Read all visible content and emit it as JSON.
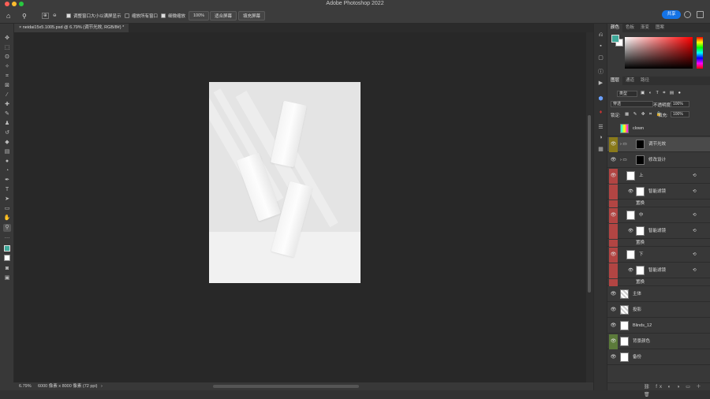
{
  "app": {
    "title": "Adobe Photoshop 2022",
    "share_label": "共享"
  },
  "options": {
    "resize_windows": "调整窗口大小以满屏显示",
    "zoom_all": "缩放所有窗口",
    "scrubby": "细微缩放",
    "zoom_value": "100%",
    "fit_screen": "适合屏幕",
    "fill_screen": "填充屏幕"
  },
  "document": {
    "tab_label": "neidai15x5.1005.psd @ 6.79% (调节光效, RGB/8#) *",
    "close": "×",
    "zoom_status": "6.79%",
    "size_status": "6000 像素 x 8000 像素 (72 ppi)",
    "arrow": "›"
  },
  "color_panel": {
    "tabs": [
      "颜色",
      "色板",
      "渐变",
      "图案"
    ],
    "fg_color": "#3fa99a",
    "bg_color": "#ffffff"
  },
  "layers_panel": {
    "tabs": [
      "图层",
      "通道",
      "路径"
    ],
    "filter_label": "类型",
    "blend_mode": "穿透",
    "opacity_label": "不透明度:",
    "opacity_value": "100%",
    "lock_label": "锁定:",
    "fill_label": "填充:",
    "fill_value": "100%",
    "layers": [
      {
        "name": "clown",
        "color": ""
      },
      {
        "name": "调节光效",
        "color": "#8a7a1a"
      },
      {
        "name": "修改设计",
        "color": ""
      },
      {
        "name": "上",
        "color": "#b24543"
      },
      {
        "name": "智能滤镜",
        "color": "#b24543"
      },
      {
        "name": "置换",
        "color": "#b24543"
      },
      {
        "name": "中",
        "color": "#b24543"
      },
      {
        "name": "智能滤镜",
        "color": "#b24543"
      },
      {
        "name": "置换",
        "color": "#b24543"
      },
      {
        "name": "下",
        "color": "#b24543"
      },
      {
        "name": "智能滤镜",
        "color": "#b24543"
      },
      {
        "name": "置换",
        "color": "#b24543"
      },
      {
        "name": "主体",
        "color": ""
      },
      {
        "name": "投影",
        "color": ""
      },
      {
        "name": "Blinds_12",
        "color": ""
      },
      {
        "name": "背景颜色",
        "color": "#5b7a3a"
      },
      {
        "name": "备份",
        "color": ""
      }
    ],
    "footer_icons": "⛓ fx ◐ ◑ ▭ ＋ 🗑"
  }
}
